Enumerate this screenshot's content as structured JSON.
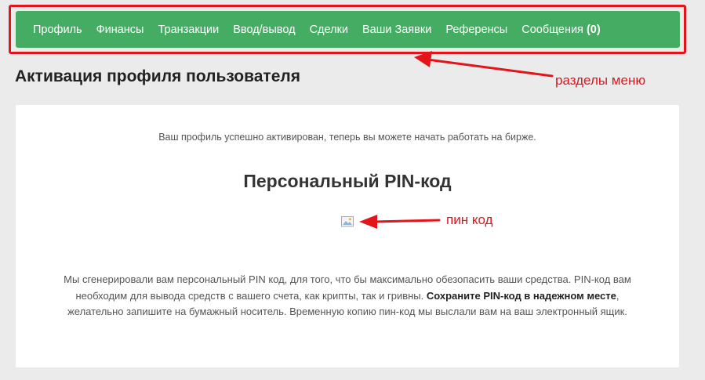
{
  "nav": {
    "items": [
      {
        "label": "Профиль"
      },
      {
        "label": "Финансы"
      },
      {
        "label": "Транзакции"
      },
      {
        "label": "Ввод/вывод"
      },
      {
        "label": "Сделки"
      },
      {
        "label": "Ваши Заявки"
      },
      {
        "label": "Референсы"
      }
    ],
    "messages": {
      "label": "Сообщения",
      "count": "(0)"
    }
  },
  "page": {
    "title": "Активация профиля пользователя"
  },
  "content": {
    "success_message": "Ваш профиль успешно активирован, теперь вы можете начать работать на бирже.",
    "pin_heading": "Персональный PIN-код",
    "desc_part1": "Мы сгенерировали вам персональный PIN код, для того, что бы максимально обезопасить ваши средства. PIN-код вам необходим для вывода средств с вашего счета, как крипты, так и гривны. ",
    "desc_bold": "Сохраните PIN-код в надежном месте",
    "desc_part2": ", желательно запишите на бумажный носитель. Временную копию пин-код мы выслали вам на ваш электронный ящик."
  },
  "annotations": {
    "menu_label": "разделы меню",
    "pin_label": "пин код",
    "color": "#e4141b"
  },
  "colors": {
    "nav_bg": "#44ad63",
    "page_bg": "#ebebeb",
    "card_bg": "#ffffff"
  }
}
